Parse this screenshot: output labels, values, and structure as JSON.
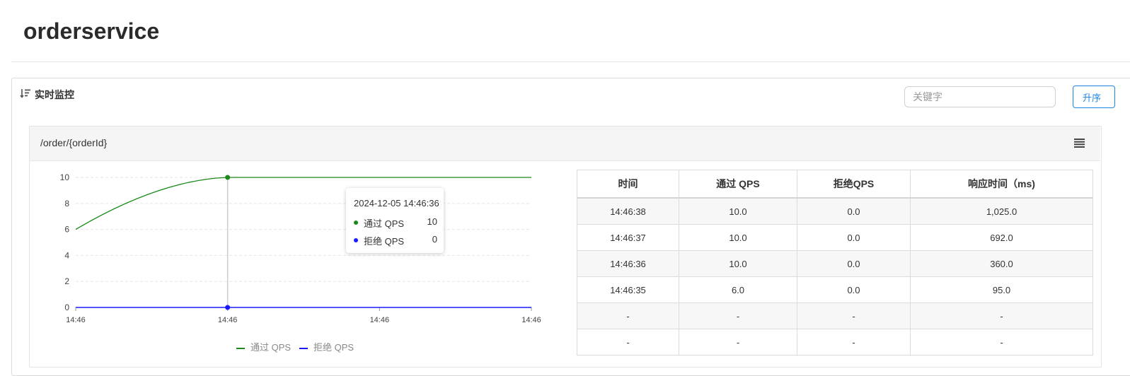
{
  "page": {
    "title": "orderservice"
  },
  "panel": {
    "label": "实时监控"
  },
  "search": {
    "placeholder": "关键字",
    "value": ""
  },
  "sort_button": {
    "label": "升序"
  },
  "resource": {
    "title": "/order/{orderId}"
  },
  "chart_data": {
    "type": "line",
    "x": [
      "14:46",
      "14:46",
      "14:46",
      "14:46"
    ],
    "ylim": [
      0,
      10
    ],
    "yticks": [
      "0",
      "2",
      "4",
      "6",
      "8",
      "10"
    ],
    "series": [
      {
        "name": "通过 QPS",
        "color": "#1b8a1b",
        "values": [
          6,
          10,
          10,
          10
        ]
      },
      {
        "name": "拒绝 QPS",
        "color": "#1a1aff",
        "values": [
          0,
          0,
          0,
          0
        ]
      }
    ],
    "tooltip": {
      "date": "2024-12-05 14:46:36",
      "rows": [
        {
          "name": "通过 QPS",
          "value": "10",
          "color": "#1b8a1b"
        },
        {
          "name": "拒绝 QPS",
          "value": "0",
          "color": "#1a1aff"
        }
      ]
    }
  },
  "table": {
    "headers": [
      "时间",
      "通过 QPS",
      "拒绝QPS",
      "响应时间（ms)"
    ],
    "rows": [
      [
        "14:46:38",
        "10.0",
        "0.0",
        "1,025.0"
      ],
      [
        "14:46:37",
        "10.0",
        "0.0",
        "692.0"
      ],
      [
        "14:46:36",
        "10.0",
        "0.0",
        "360.0"
      ],
      [
        "14:46:35",
        "6.0",
        "0.0",
        "95.0"
      ],
      [
        "-",
        "-",
        "-",
        "-"
      ],
      [
        "-",
        "-",
        "-",
        "-"
      ]
    ]
  }
}
